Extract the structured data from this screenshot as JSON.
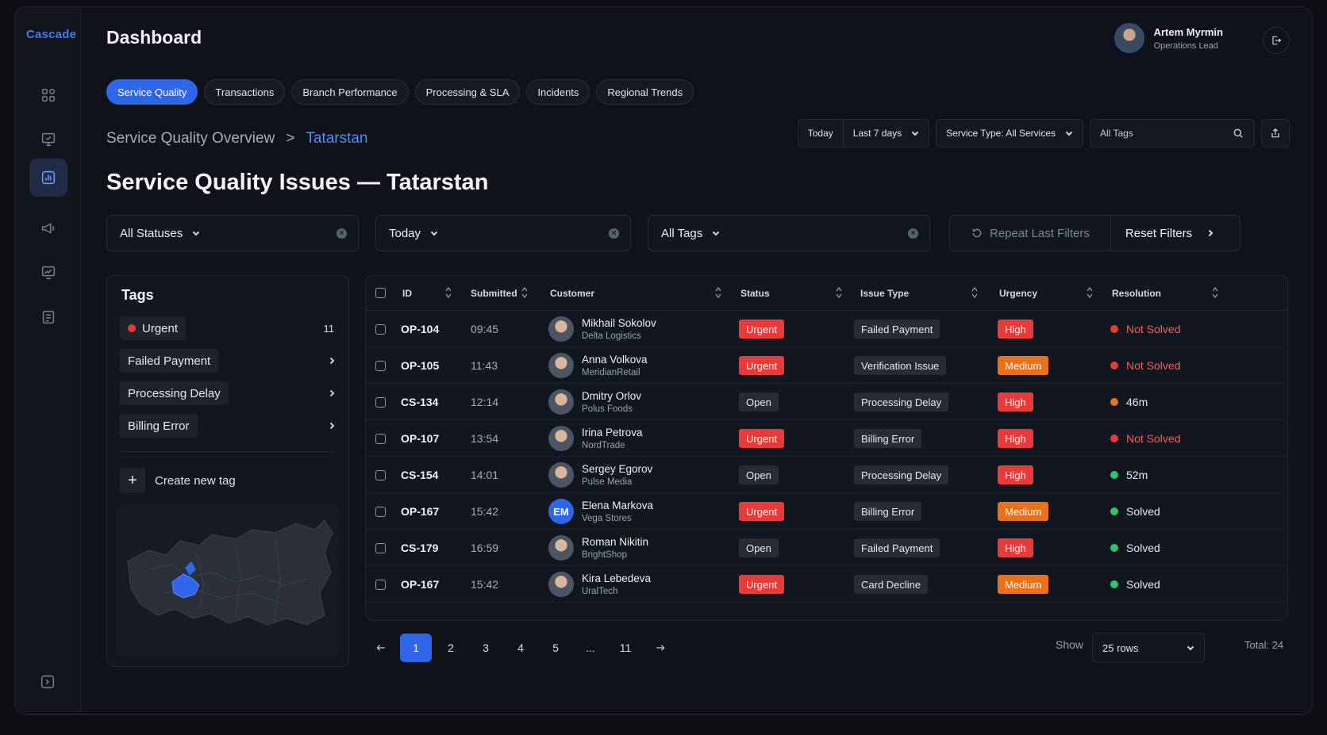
{
  "brand": "Cascade",
  "header": {
    "title": "Dashboard",
    "user_name": "Artem Myrmin",
    "user_role": "Operations Lead"
  },
  "tabs": [
    {
      "label": "Service Quality",
      "active": true
    },
    {
      "label": "Transactions",
      "active": false
    },
    {
      "label": "Branch Performance",
      "active": false
    },
    {
      "label": "Processing & SLA",
      "active": false
    },
    {
      "label": "Incidents",
      "active": false
    },
    {
      "label": "Regional Trends",
      "active": false
    }
  ],
  "breadcrumb": {
    "parent": "Service Quality Overview",
    "separator": ">",
    "current": "Tatarstan"
  },
  "top_filters": {
    "today": "Today",
    "range": "Last 7 days",
    "service_type": "Service Type: All Services",
    "tags_placeholder": "All Tags"
  },
  "page_title": "Service Quality Issues — Tatarstan",
  "filters": {
    "statuses": "All Statuses",
    "date": "Today",
    "tags": "All Tags",
    "repeat": "Repeat Last Filters",
    "reset": "Reset Filters"
  },
  "tags_panel": {
    "title": "Tags",
    "items": [
      {
        "label": "Urgent",
        "count": "11",
        "dot": "#e63b3b"
      },
      {
        "label": "Failed Payment"
      },
      {
        "label": "Processing Delay"
      },
      {
        "label": "Billing Error"
      }
    ],
    "create_label": "Create new tag"
  },
  "table": {
    "columns": [
      "ID",
      "Submitted",
      "Customer",
      "Status",
      "Issue Type",
      "Urgency",
      "Resolution"
    ],
    "rows": [
      {
        "id": "OP-104",
        "time": "09:45",
        "name": "Mikhail Sokolov",
        "company": "Delta Logistics",
        "status": "Urgent",
        "issue": "Failed Payment",
        "urgency": "High",
        "resolution": "Not Solved",
        "res_color": "#e63b3b"
      },
      {
        "id": "OP-105",
        "time": "11:43",
        "name": "Anna Volkova",
        "company": "MeridianRetail",
        "status": "Urgent",
        "issue": "Verification Issue",
        "urgency": "Medium",
        "resolution": "Not Solved",
        "res_color": "#e63b3b"
      },
      {
        "id": "CS-134",
        "time": "12:14",
        "name": "Dmitry Orlov",
        "company": "Polus Foods",
        "status": "Open",
        "issue": "Processing Delay",
        "urgency": "High",
        "resolution": "46m",
        "res_color": "#e8711c"
      },
      {
        "id": "OP-107",
        "time": "13:54",
        "name": "Irina Petrova",
        "company": "NordTrade",
        "status": "Urgent",
        "issue": "Billing Error",
        "urgency": "High",
        "resolution": "Not Solved",
        "res_color": "#e63b3b"
      },
      {
        "id": "CS-154",
        "time": "14:01",
        "name": "Sergey Egorov",
        "company": "Pulse Media",
        "status": "Open",
        "issue": "Processing Delay",
        "urgency": "High",
        "resolution": "52m",
        "res_color": "#2fc46b"
      },
      {
        "id": "OP-167",
        "time": "15:42",
        "name": "Elena Markova",
        "company": "Vega Stores",
        "status": "Urgent",
        "issue": "Billing Error",
        "urgency": "Medium",
        "resolution": "Solved",
        "res_color": "#2fc46b",
        "initials": "EM"
      },
      {
        "id": "CS-179",
        "time": "16:59",
        "name": "Roman Nikitin",
        "company": "BrightShop",
        "status": "Open",
        "issue": "Failed Payment",
        "urgency": "High",
        "resolution": "Solved",
        "res_color": "#2fc46b"
      },
      {
        "id": "OP-167",
        "time": "15:42",
        "name": "Kira Lebedeva",
        "company": "UralTech",
        "status": "Urgent",
        "issue": "Card Decline",
        "urgency": "Medium",
        "resolution": "Solved",
        "res_color": "#2fc46b"
      }
    ]
  },
  "pagination": {
    "pages": [
      "1",
      "2",
      "3",
      "4",
      "5",
      "...",
      "11"
    ],
    "current": "1",
    "show_label": "Show",
    "rows_option": "25 rows",
    "total": "Total: 24"
  },
  "colors": {
    "accent": "#2f66e8",
    "link": "#4f8cff",
    "urgent": "#e63b3b",
    "medium": "#e8711c",
    "solved": "#2fc46b"
  }
}
